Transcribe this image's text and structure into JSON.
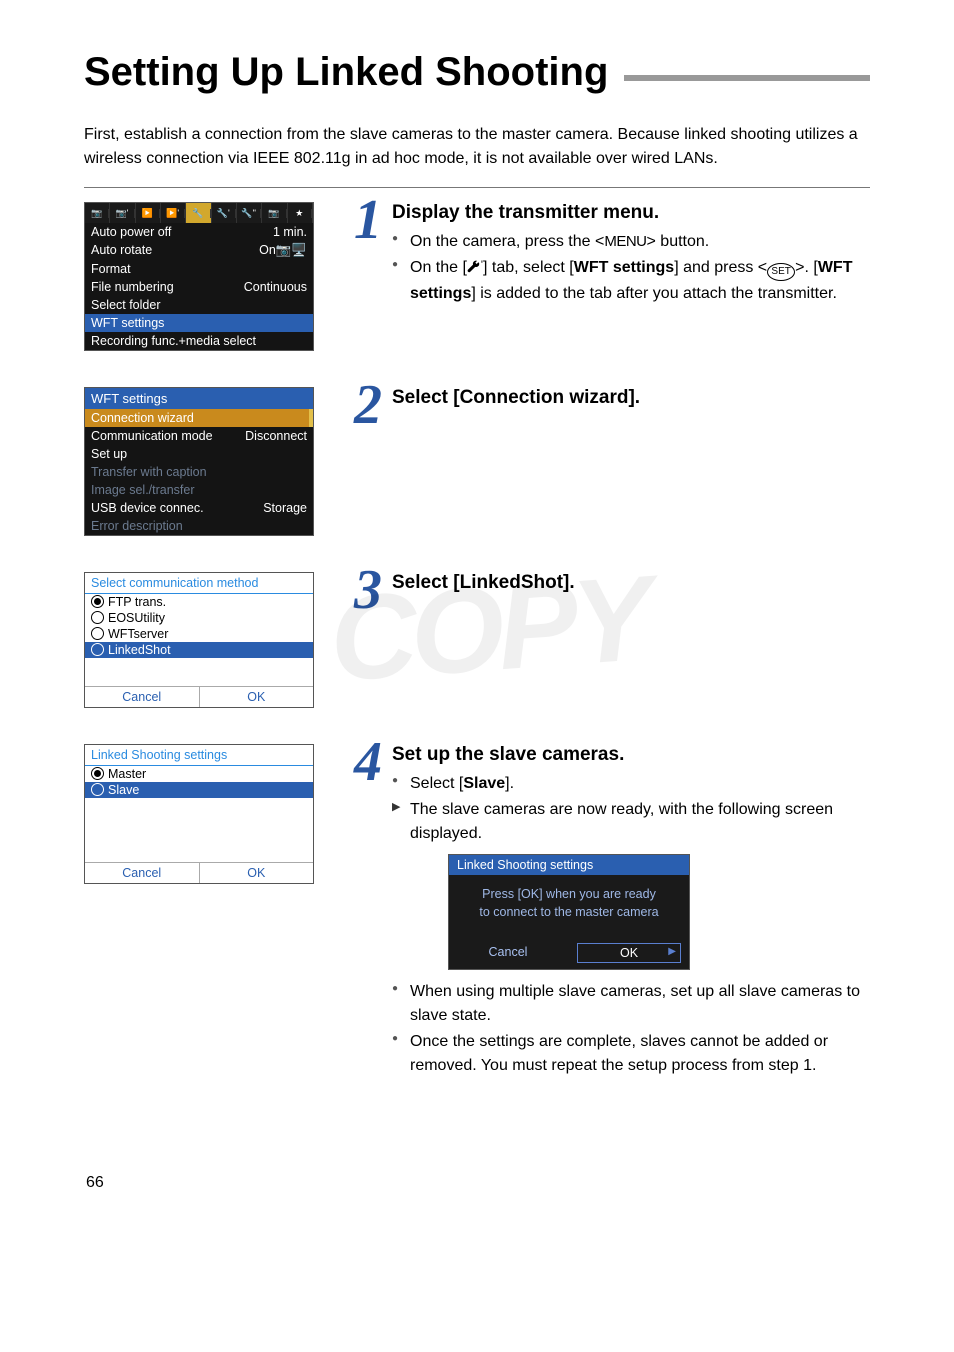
{
  "title": "Setting Up Linked Shooting",
  "intro": "First, establish a connection from the slave cameras to the master camera. Because linked shooting utilizes a wireless connection via IEEE 802.11g in ad hoc mode, it is not available over wired LANs.",
  "page_number": "66",
  "watermark": "COPY",
  "steps": {
    "s1": {
      "num": "1",
      "title": "Display the transmitter menu.",
      "b1_pre": "On the camera, press the <",
      "b1_menu": "MENU",
      "b1_post": "> button.",
      "b2_pre": "On the [",
      "b2_mid1": "] tab, select [",
      "b2_bold1": "WFT settings",
      "b2_mid2": "] and press <",
      "b2_set": "SET",
      "b2_mid3": ">. [",
      "b2_bold2": "WFT settings",
      "b2_post": "] is added to the tab after you attach the transmitter."
    },
    "s2": {
      "num": "2",
      "title": "Select [Connection wizard]."
    },
    "s3": {
      "num": "3",
      "title": "Select [LinkedShot]."
    },
    "s4": {
      "num": "4",
      "title": "Set up the slave cameras.",
      "b1_pre": "Select [",
      "b1_bold": "Slave",
      "b1_post": "].",
      "b2": "The slave cameras are now ready, with the following screen displayed.",
      "b3": "When using multiple slave cameras, set up all slave cameras to slave state.",
      "b4": "Once the settings are complete, slaves cannot be added or removed. You must repeat the setup process from step 1."
    }
  },
  "cam1": {
    "rows": {
      "r1": {
        "lab": "Auto power off",
        "val": "1 min."
      },
      "r2": {
        "lab": "Auto rotate",
        "val": "On"
      },
      "r3": {
        "lab": "Format"
      },
      "r4": {
        "lab": "File numbering",
        "val": "Continuous"
      },
      "r5": {
        "lab": "Select folder"
      },
      "r6": {
        "lab": "WFT settings"
      },
      "r7": {
        "lab": "Recording func.+media select"
      }
    }
  },
  "cam2": {
    "hdr": "WFT settings",
    "rows": {
      "r1": "Connection wizard",
      "r2": {
        "lab": "Communication mode",
        "val": "Disconnect"
      },
      "r3": "Set up",
      "r4": "Transfer with caption",
      "r5": "Image sel./transfer",
      "r6": {
        "lab": "USB device connec.",
        "val": "Storage"
      },
      "r7": "Error description"
    }
  },
  "cam3": {
    "title": "Select communication method",
    "opts": {
      "o1": "FTP trans.",
      "o2": "EOSUtility",
      "o3": "WFTserver",
      "o4": "LinkedShot"
    },
    "cancel": "Cancel",
    "ok": "OK"
  },
  "cam4": {
    "title": "Linked Shooting settings",
    "opts": {
      "o1": "Master",
      "o2": "Slave"
    },
    "cancel": "Cancel",
    "ok": "OK"
  },
  "cam5": {
    "title": "Linked Shooting settings",
    "msg1": "Press [OK] when you are ready",
    "msg2": "to connect to the master camera",
    "cancel": "Cancel",
    "ok": "OK"
  }
}
